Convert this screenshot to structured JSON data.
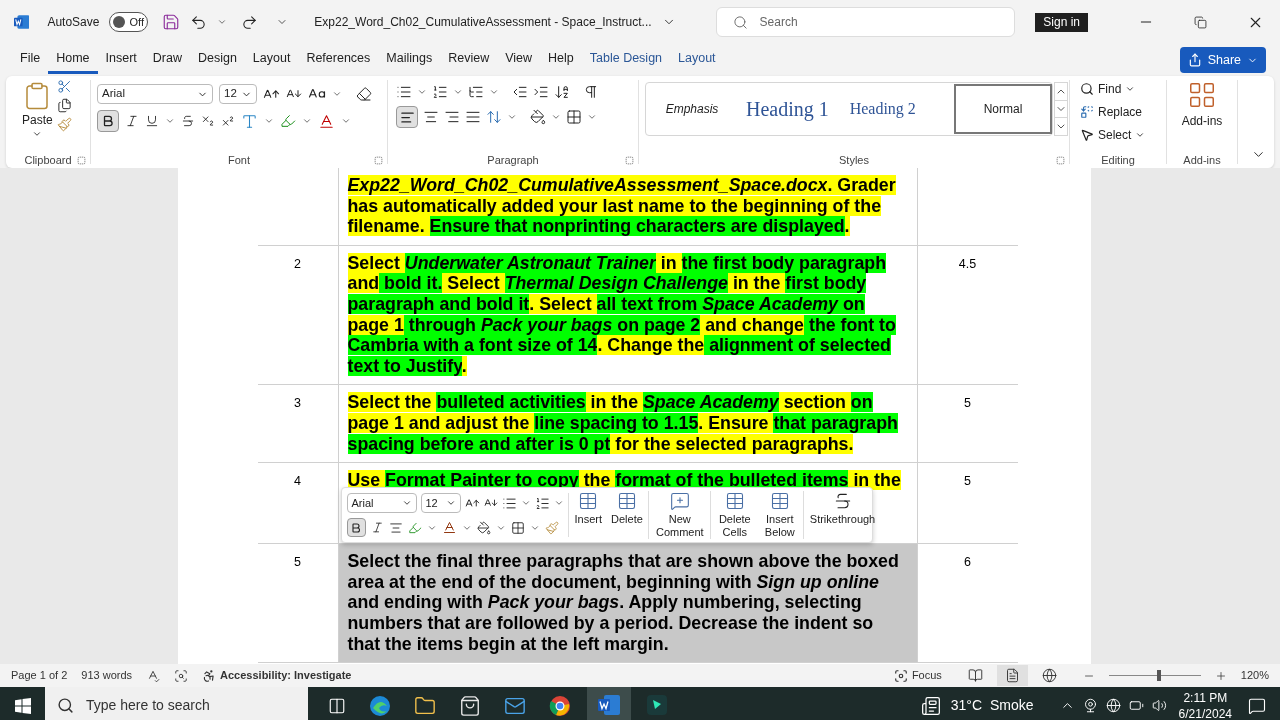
{
  "window": {
    "title": "Exp22_Word_Ch02_CumulativeAssessment - Space_Instruct...",
    "autosave": {
      "label": "AutoSave",
      "on": false,
      "state_text": "Off"
    },
    "search": {
      "placeholder": "Search"
    },
    "sign_in": "Sign in"
  },
  "tabs": [
    {
      "label": "File",
      "selected": false,
      "kind": "standard"
    },
    {
      "label": "Home",
      "selected": true,
      "kind": "standard"
    },
    {
      "label": "Insert",
      "selected": false,
      "kind": "standard"
    },
    {
      "label": "Draw",
      "selected": false,
      "kind": "standard"
    },
    {
      "label": "Design",
      "selected": false,
      "kind": "standard"
    },
    {
      "label": "Layout",
      "selected": false,
      "kind": "standard"
    },
    {
      "label": "References",
      "selected": false,
      "kind": "standard"
    },
    {
      "label": "Mailings",
      "selected": false,
      "kind": "standard"
    },
    {
      "label": "Review",
      "selected": false,
      "kind": "standard"
    },
    {
      "label": "View",
      "selected": false,
      "kind": "standard"
    },
    {
      "label": "Help",
      "selected": false,
      "kind": "standard"
    },
    {
      "label": "Table Design",
      "selected": false,
      "kind": "contextual"
    },
    {
      "label": "Layout",
      "selected": false,
      "kind": "contextual"
    }
  ],
  "share": "Share",
  "ribbon": {
    "clipboard": {
      "paste": "Paste",
      "label": "Clipboard"
    },
    "font": {
      "face": "Arial",
      "size": "12",
      "bold_on": true,
      "label": "Font"
    },
    "paragraph": {
      "align_left_on": true,
      "label": "Paragraph"
    },
    "styles": {
      "label": "Styles",
      "items": [
        {
          "label": "Emphasis",
          "kind": "emphasis",
          "selected": false
        },
        {
          "label": "Heading 1",
          "kind": "heading1",
          "selected": false
        },
        {
          "label": "Heading 2",
          "kind": "heading2",
          "selected": false
        },
        {
          "label": "Normal",
          "kind": "normal",
          "selected": true
        }
      ]
    },
    "editing": {
      "label": "Editing",
      "items": [
        "Find",
        "Replace",
        "Select"
      ]
    },
    "addins": {
      "button": "Add-ins",
      "label": "Add-ins"
    }
  },
  "table": {
    "rows": [
      {
        "selected": false,
        "segments": [
          {
            "text": "*Exp22_Word_Ch02_CumulativeAssessment_Space.docx*",
            "color": "#ffff00"
          },
          {
            "text": ". Grader has automatically added your last name to the beginning of the filename. ",
            "color": "#ffff00"
          },
          {
            "text": "Ensure that nonprinting characters are displayed",
            "color": "#00ff00"
          },
          {
            "text": ".",
            "color": "#ffff00"
          }
        ]
      },
      {
        "number": "2",
        "points": "4.5",
        "selected": false,
        "segments": [
          {
            "text": "Select ",
            "color": "#ffff00"
          },
          {
            "text": "*Underwater Astronaut Trainer*",
            "color": "#00ff00"
          },
          {
            "text": " in ",
            "color": "#ffff00"
          },
          {
            "text": "the first body paragraph ",
            "color": "#00ff00"
          },
          {
            "text": "and",
            "color": "#ffff00"
          },
          {
            "text": " bold it.",
            "color": "#00ff00"
          },
          {
            "text": " Select ",
            "color": "#ffff00"
          },
          {
            "text": "*Thermal Design Challenge*",
            "color": "#00ff00"
          },
          {
            "text": " in the ",
            "color": "#ffff00"
          },
          {
            "text": "first body paragraph and bold it",
            "color": "#00ff00"
          },
          {
            "text": ". Select ",
            "color": "#ffff00"
          },
          {
            "text": "all text from *Space Academy* on ",
            "color": "#00ff00"
          },
          {
            "text": "page 1",
            "color": "#ffff00"
          },
          {
            "text": " through *Pack your bags* on page 2",
            "color": "#00ff00"
          },
          {
            "text": " and change",
            "color": "#ffff00"
          },
          {
            "text": " the font to Cambria with a font size of 14",
            "color": "#00ff00"
          },
          {
            "text": ". Change the",
            "color": "#ffff00"
          },
          {
            "text": " alignment of selected text to Justify",
            "color": "#00ff00"
          },
          {
            "text": ".",
            "color": "#ffff00"
          }
        ]
      },
      {
        "number": "3",
        "points": "5",
        "selected": false,
        "segments": [
          {
            "text": "Select the ",
            "color": "#ffff00"
          },
          {
            "text": "bulleted activities",
            "color": "#00ff00"
          },
          {
            "text": " in the ",
            "color": "#ffff00"
          },
          {
            "text": "*Space Academy*",
            "color": "#00ff00"
          },
          {
            "text": " section ",
            "color": "#ffff00"
          },
          {
            "text": "on",
            "color": "#00ff00"
          },
          {
            "text": " page 1 and adjust the ",
            "color": "#ffff00"
          },
          {
            "text": "line spacing to 1.15",
            "color": "#00ff00"
          },
          {
            "text": ". Ensure ",
            "color": "#ffff00"
          },
          {
            "text": "that paragraph spacing before and after is 0 pt",
            "color": "#00ff00"
          },
          {
            "text": " for the selected paragraphs.",
            "color": "#ffff00"
          }
        ]
      },
      {
        "number": "4",
        "points": "5",
        "selected": false,
        "segments": [
          {
            "text": "Use ",
            "color": "#ffff00"
          },
          {
            "text": "Format Painter to copy",
            "color": "#00ff00"
          },
          {
            "text": " the ",
            "color": "#ffff00"
          },
          {
            "text": "format of the bulleted items",
            "color": "#00ff00"
          },
          {
            "text": " in the",
            "color": "#ffff00"
          }
        ]
      },
      {
        "number": "5",
        "points": "6",
        "selected": true,
        "segments": [
          {
            "text": "Select the final three paragraphs that are shown above the boxed area at the end of the document, beginning with *Sign up online* and ending with *Pack your bags*. Apply numbering, selecting numbers that are followed by a period. Decrease the indent so that the items begin at the left margin."
          }
        ]
      }
    ]
  },
  "mini_toolbar": {
    "face": "Arial",
    "size": "12",
    "bold_on": true,
    "buttons": [
      "Insert",
      "Delete",
      "New Comment",
      "Delete Cells",
      "Insert Below",
      "Strikethrough"
    ]
  },
  "status_bar": {
    "page": "Page 1 of 2",
    "words": "913 words",
    "accessibility": "Accessibility: Investigate",
    "focus": "Focus",
    "zoom_slider": {
      "level": 0.55
    },
    "zoom": "120%"
  },
  "taskbar": {
    "search_placeholder": "Type here to search",
    "temperature": "31°C",
    "weather": "Smoke",
    "time": "2:11 PM",
    "date": "6/21/2024"
  }
}
